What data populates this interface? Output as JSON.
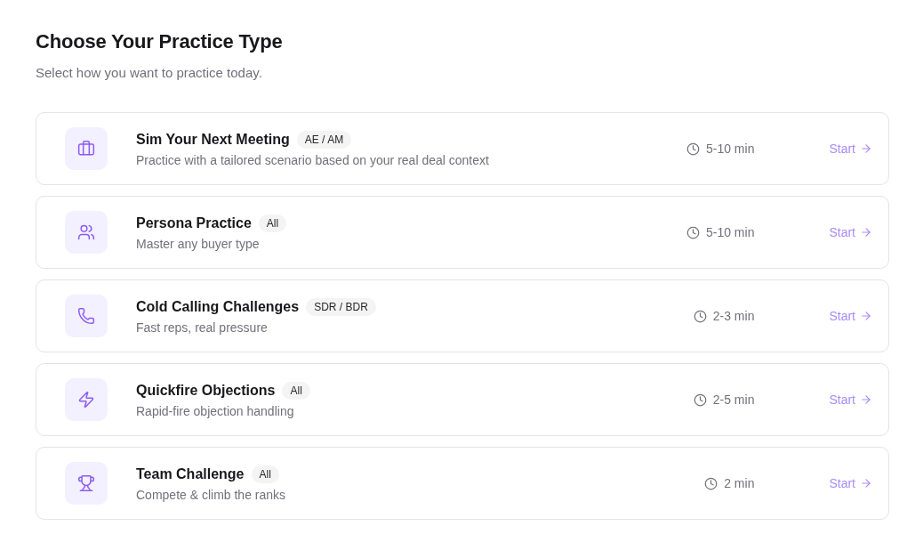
{
  "header": {
    "title": "Choose Your Practice Type",
    "subtitle": "Select how you want to practice today."
  },
  "practice_types": [
    {
      "title": "Sim Your Next Meeting",
      "badge": "AE / AM",
      "description": "Practice with a tailored scenario based on your real deal context",
      "duration": "5-10 min",
      "action": "Start"
    },
    {
      "title": "Persona Practice",
      "badge": "All",
      "description": "Master any buyer type",
      "duration": "5-10 min",
      "action": "Start"
    },
    {
      "title": "Cold Calling Challenges",
      "badge": "SDR / BDR",
      "description": "Fast reps, real pressure",
      "duration": "2-3 min",
      "action": "Start"
    },
    {
      "title": "Quickfire Objections",
      "badge": "All",
      "description": "Rapid-fire objection handling",
      "duration": "2-5 min",
      "action": "Start"
    },
    {
      "title": "Team Challenge",
      "badge": "All",
      "description": "Compete & climb the ranks",
      "duration": "2 min",
      "action": "Start"
    }
  ]
}
